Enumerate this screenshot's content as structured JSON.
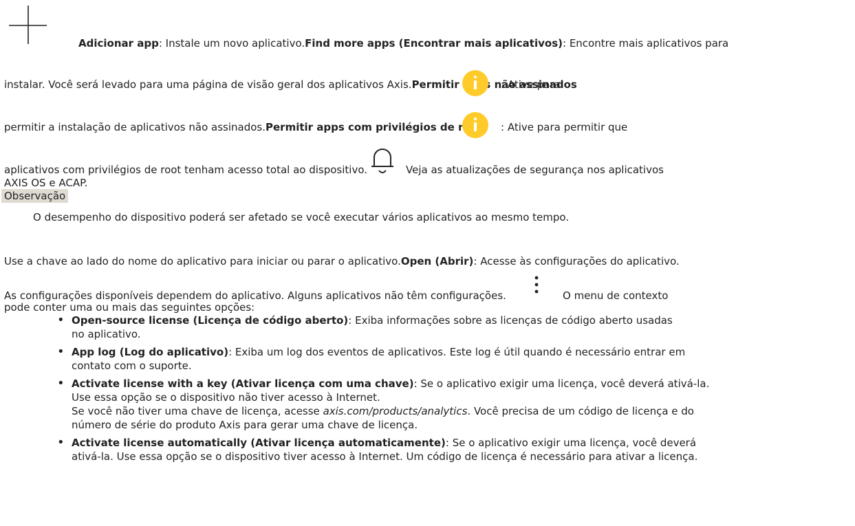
{
  "add_app": {
    "label": "Adicionar app",
    "desc": ": Instale um novo aplicativo."
  },
  "find_more": {
    "label": "Find more apps (Encontrar mais aplicativos)",
    "desc_a": ": Encontre mais aplicativos para",
    "desc_b": "instalar. Você será levado para uma página de visão geral dos aplicativos Axis."
  },
  "unsigned": {
    "label": "Permitir apps não assinados",
    "desc_a": ": Ative para",
    "desc_b": "permitir a instalação de aplicativos não assinados."
  },
  "root": {
    "label": "Permitir apps com privilégios de root",
    "desc_a": ": Ative para permitir que",
    "desc_b": "aplicativos com privilégios de root tenham acesso total ao dispositivo."
  },
  "security_updates": {
    "line1": "Veja as atualizações de segurança nos aplicativos",
    "line2": "AXIS OS e ACAP."
  },
  "note": {
    "label": "Observação",
    "text": "O desempenho do dispositivo poderá ser afetado se você executar vários aplicativos ao mesmo tempo."
  },
  "toggle": {
    "text": "Use a chave ao lado do nome do aplicativo para iniciar ou parar o aplicativo."
  },
  "open": {
    "label": "Open (Abrir)",
    "desc": ": Acesse às configurações do aplicativo."
  },
  "settings": {
    "line1": "As configurações disponíveis dependem do aplicativo. Alguns aplicativos não têm configurações.",
    "menu_a": "O menu de contexto",
    "menu_b": "pode conter uma ou mais das seguintes opções:"
  },
  "options": {
    "opensource": {
      "label": "Open-source license (Licença de código aberto)",
      "desc_a": ": Exiba informações sobre as licenças de código aberto usadas",
      "desc_b": "no aplicativo."
    },
    "applog": {
      "label": "App log (Log do aplicativo)",
      "desc_a": ": Exiba um log dos eventos de aplicativos. Este log é útil quando é necessário entrar em",
      "desc_b": "contato com o suporte."
    },
    "keylicense": {
      "label": "Activate license with a key (Ativar licença com uma chave)",
      "desc_a": ": Se o aplicativo exigir uma licença, você deverá ativá-la.",
      "desc_b": "Use essa opção se o dispositivo não tiver acesso à Internet.",
      "desc_c": "Se você não tiver uma chave de licença, acesse ",
      "link": "axis.com/products/analytics",
      "desc_d": ". Você precisa de um código de licença e do",
      "desc_e": "número de série do produto Axis para gerar uma chave de licença."
    },
    "autolicense": {
      "label": "Activate license automatically (Ativar licença automaticamente)",
      "desc_a": ": Se o aplicativo exigir uma licença, você deverá",
      "desc_b": "ativá-la. Use essa opção se o dispositivo tiver acesso à Internet. Um código de licença é necessário para ativar a licença."
    }
  },
  "colors": {
    "info_badge": "#ffcb2b",
    "note_bg": "#e0dbd2"
  },
  "icons": [
    "plus-icon",
    "info-icon",
    "bell-icon",
    "more-vertical-icon"
  ]
}
